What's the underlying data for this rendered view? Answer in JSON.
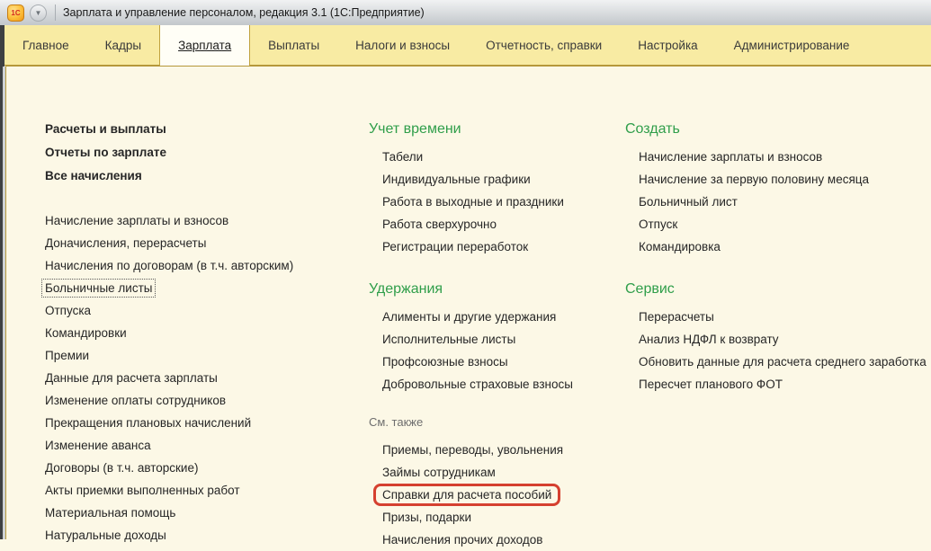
{
  "titlebar": {
    "title": "Зарплата и управление персоналом, редакция 3.1  (1С:Предприятие)",
    "app_icon_glyph": "1С",
    "menu_button_glyph": "▼"
  },
  "tabs": [
    "Главное",
    "Кадры",
    "Зарплата",
    "Выплаты",
    "Налоги и взносы",
    "Отчетность, справки",
    "Настройка",
    "Администрирование"
  ],
  "active_tab": "Зарплата",
  "nav": {
    "featured": [
      "Расчеты и выплаты",
      "Отчеты по зарплате",
      "Все начисления"
    ],
    "left_items": [
      "Начисление зарплаты и взносов",
      "Доначисления, перерасчеты",
      "Начисления по договорам (в т.ч. авторским)",
      "Больничные листы",
      "Отпуска",
      "Командировки",
      "Премии",
      "Данные для расчета зарплаты",
      "Изменение оплаты сотрудников",
      "Прекращения плановых начислений",
      "Изменение аванса",
      "Договоры (в т.ч. авторские)",
      "Акты приемки выполненных работ",
      "Материальная помощь",
      "Натуральные доходы"
    ],
    "focused_item": "Больничные листы",
    "time_section": {
      "title": "Учет времени",
      "items": [
        "Табели",
        "Индивидуальные графики",
        "Работа в выходные и праздники",
        "Работа сверхурочно",
        "Регистрации переработок"
      ]
    },
    "deduction_section": {
      "title": "Удержания",
      "items": [
        "Алименты и другие удержания",
        "Исполнительные листы",
        "Профсоюзные взносы",
        "Добровольные страховые взносы"
      ]
    },
    "see_also_section": {
      "title": "См. также",
      "items": [
        "Приемы, переводы, увольнения",
        "Займы сотрудникам",
        "Справки для расчета пособий",
        "Призы, подарки",
        "Начисления прочих доходов"
      ]
    },
    "highlighted_item": "Справки для расчета пособий",
    "create_section": {
      "title": "Создать",
      "items": [
        "Начисление зарплаты и взносов",
        "Начисление за первую половину месяца",
        "Больничный лист",
        "Отпуск",
        "Командировка"
      ]
    },
    "service_section": {
      "title": "Сервис",
      "items": [
        "Перерасчеты",
        "Анализ НДФЛ к возврату",
        "Обновить данные для расчета среднего заработка",
        "Пересчет планового ФОТ"
      ]
    }
  },
  "colors": {
    "section_header_green": "#2f9e4a",
    "highlight_red": "#d5402f",
    "tabbar_yellow": "#f8eba3",
    "content_cream": "#fcf8e6",
    "gold_border": "#b5983a"
  }
}
